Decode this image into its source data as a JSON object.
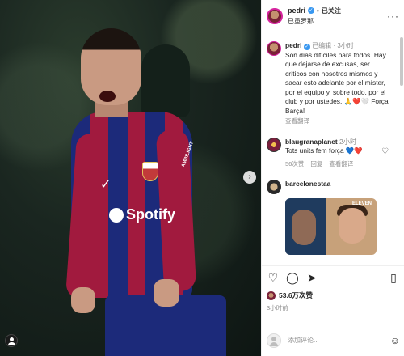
{
  "header": {
    "username": "pedri",
    "separator": "•",
    "follow_status": "已关注",
    "subline": "已重罗那",
    "more_icon": "more-horizontal-icon"
  },
  "caption": {
    "username": "pedri",
    "edited": "已编辑",
    "time": "· 3小时",
    "text": "Son días difíciles para todos. Hay que dejarse de excusas, ser críticos con nosotros mismos y sacar esto adelante por el míster, por el equipo y, sobre todo, por el club y por ustedes. 🙏❤️🤍 Força Barça!",
    "translate": "查看翻译"
  },
  "comments": [
    {
      "username": "blaugranaplanet",
      "time": "2小时",
      "text": "Tots units fem força 💙❤️",
      "likes": "56次赞",
      "reply": "回复",
      "translate": "查看翻译"
    },
    {
      "username": "barcelonestaa",
      "image_label": "ELEVEN"
    }
  ],
  "actions": {
    "likes": "53.6万次赞",
    "time": "3小时前"
  },
  "comment_input": {
    "placeholder": "添加评论..."
  },
  "photo": {
    "sponsor": "Spotify",
    "sleeve": "AMBILIGHT"
  },
  "colors": {
    "accent": "#3897f0",
    "barca_blue": "#1c2a7a",
    "barca_red": "#a11a3e"
  }
}
